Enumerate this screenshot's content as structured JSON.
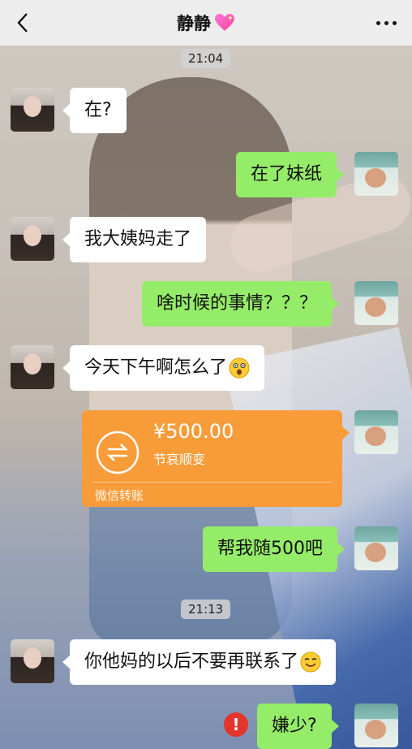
{
  "nav": {
    "title": "静静",
    "title_icon": "sparkling-heart-icon",
    "back_icon": "chevron-left-icon",
    "more_icon": "more-dots-icon"
  },
  "colors": {
    "bubble_me": "#95ec69",
    "bubble_other": "#ffffff",
    "transfer": "#f89c3a",
    "error": "#e3352b"
  },
  "timestamps": [
    "21:04",
    "21:13"
  ],
  "messages": [
    {
      "from": "other",
      "text": "在?"
    },
    {
      "from": "me",
      "text": "在了妹纸"
    },
    {
      "from": "other",
      "text": "我大姨妈走了"
    },
    {
      "from": "me",
      "text": "啥时候的事情？？？"
    },
    {
      "from": "other",
      "text": "今天下午啊怎么了",
      "emoji": "astonished-face-icon"
    },
    {
      "from": "me",
      "text": "帮我随500吧"
    },
    {
      "from": "other",
      "text": "你他妈的以后不要再联系了",
      "emoji": "smiling-face-icon"
    },
    {
      "from": "me",
      "text": "嫌少?",
      "status": "failed"
    }
  ],
  "transfer": {
    "amount": "¥500.00",
    "note": "节哀顺变",
    "footer": "微信转账",
    "icon": "transfer-arrows-icon"
  },
  "error_mark": "!"
}
